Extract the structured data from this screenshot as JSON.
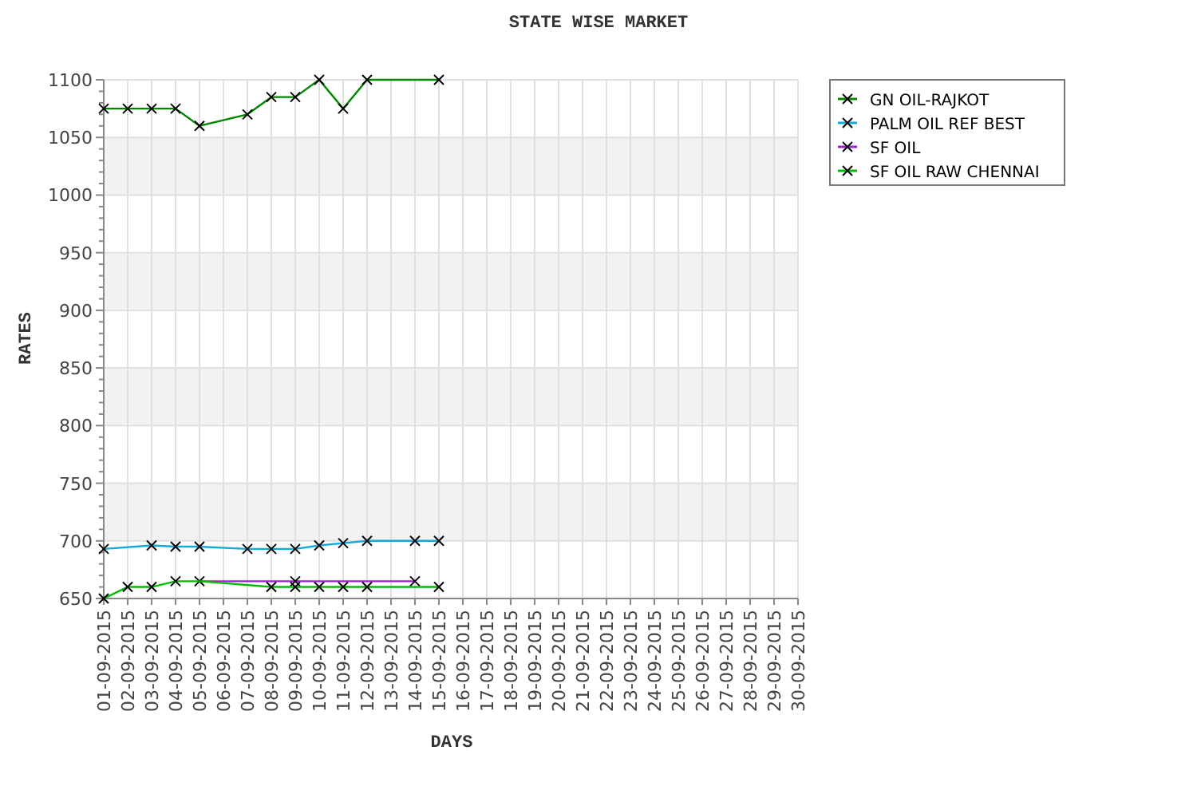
{
  "chart_data": {
    "type": "line",
    "title": "STATE WISE MARKET",
    "xlabel": "DAYS",
    "ylabel": "RATES",
    "categories": [
      "01-09-2015",
      "02-09-2015",
      "03-09-2015",
      "04-09-2015",
      "05-09-2015",
      "06-09-2015",
      "07-09-2015",
      "08-09-2015",
      "09-09-2015",
      "10-09-2015",
      "11-09-2015",
      "12-09-2015",
      "13-09-2015",
      "14-09-2015",
      "15-09-2015",
      "16-09-2015",
      "17-09-2015",
      "18-09-2015",
      "19-09-2015",
      "20-09-2015",
      "21-09-2015",
      "22-09-2015",
      "23-09-2015",
      "24-09-2015",
      "25-09-2015",
      "26-09-2015",
      "27-09-2015",
      "28-09-2015",
      "29-09-2015",
      "30-09-2015"
    ],
    "series": [
      {
        "name": "GN OIL-RAJKOT",
        "color": "#008800",
        "marker": "x",
        "values": [
          1075,
          1075,
          1075,
          1075,
          1060,
          null,
          1070,
          1085,
          1085,
          1100,
          1075,
          1100,
          null,
          null,
          1100,
          null,
          null,
          null,
          null,
          null,
          null,
          null,
          null,
          null,
          null,
          null,
          null,
          null,
          null,
          null
        ]
      },
      {
        "name": "PALM OIL REF BEST",
        "color": "#11aadd",
        "marker": "x",
        "values": [
          693,
          null,
          696,
          695,
          695,
          null,
          693,
          693,
          693,
          696,
          698,
          700,
          null,
          700,
          700,
          null,
          null,
          null,
          null,
          null,
          null,
          null,
          null,
          null,
          null,
          null,
          null,
          null,
          null,
          null
        ]
      },
      {
        "name": "SF OIL",
        "color": "#9922cc",
        "marker": "x",
        "values": [
          null,
          null,
          null,
          null,
          665,
          null,
          null,
          null,
          665,
          null,
          null,
          null,
          null,
          665,
          null,
          null,
          null,
          null,
          null,
          null,
          null,
          null,
          null,
          null,
          null,
          null,
          null,
          null,
          null,
          null
        ]
      },
      {
        "name": "SF OIL RAW CHENNAI",
        "color": "#00bb00",
        "marker": "x",
        "values": [
          650,
          660,
          660,
          665,
          665,
          null,
          null,
          660,
          660,
          660,
          660,
          660,
          null,
          null,
          660,
          null,
          null,
          null,
          null,
          null,
          null,
          null,
          null,
          null,
          null,
          null,
          null,
          null,
          null,
          null
        ]
      }
    ],
    "grid": true,
    "legend": true,
    "ylim": [
      650,
      1100
    ],
    "yticks": [
      650,
      700,
      750,
      800,
      850,
      900,
      950,
      1000,
      1050,
      1100
    ]
  }
}
